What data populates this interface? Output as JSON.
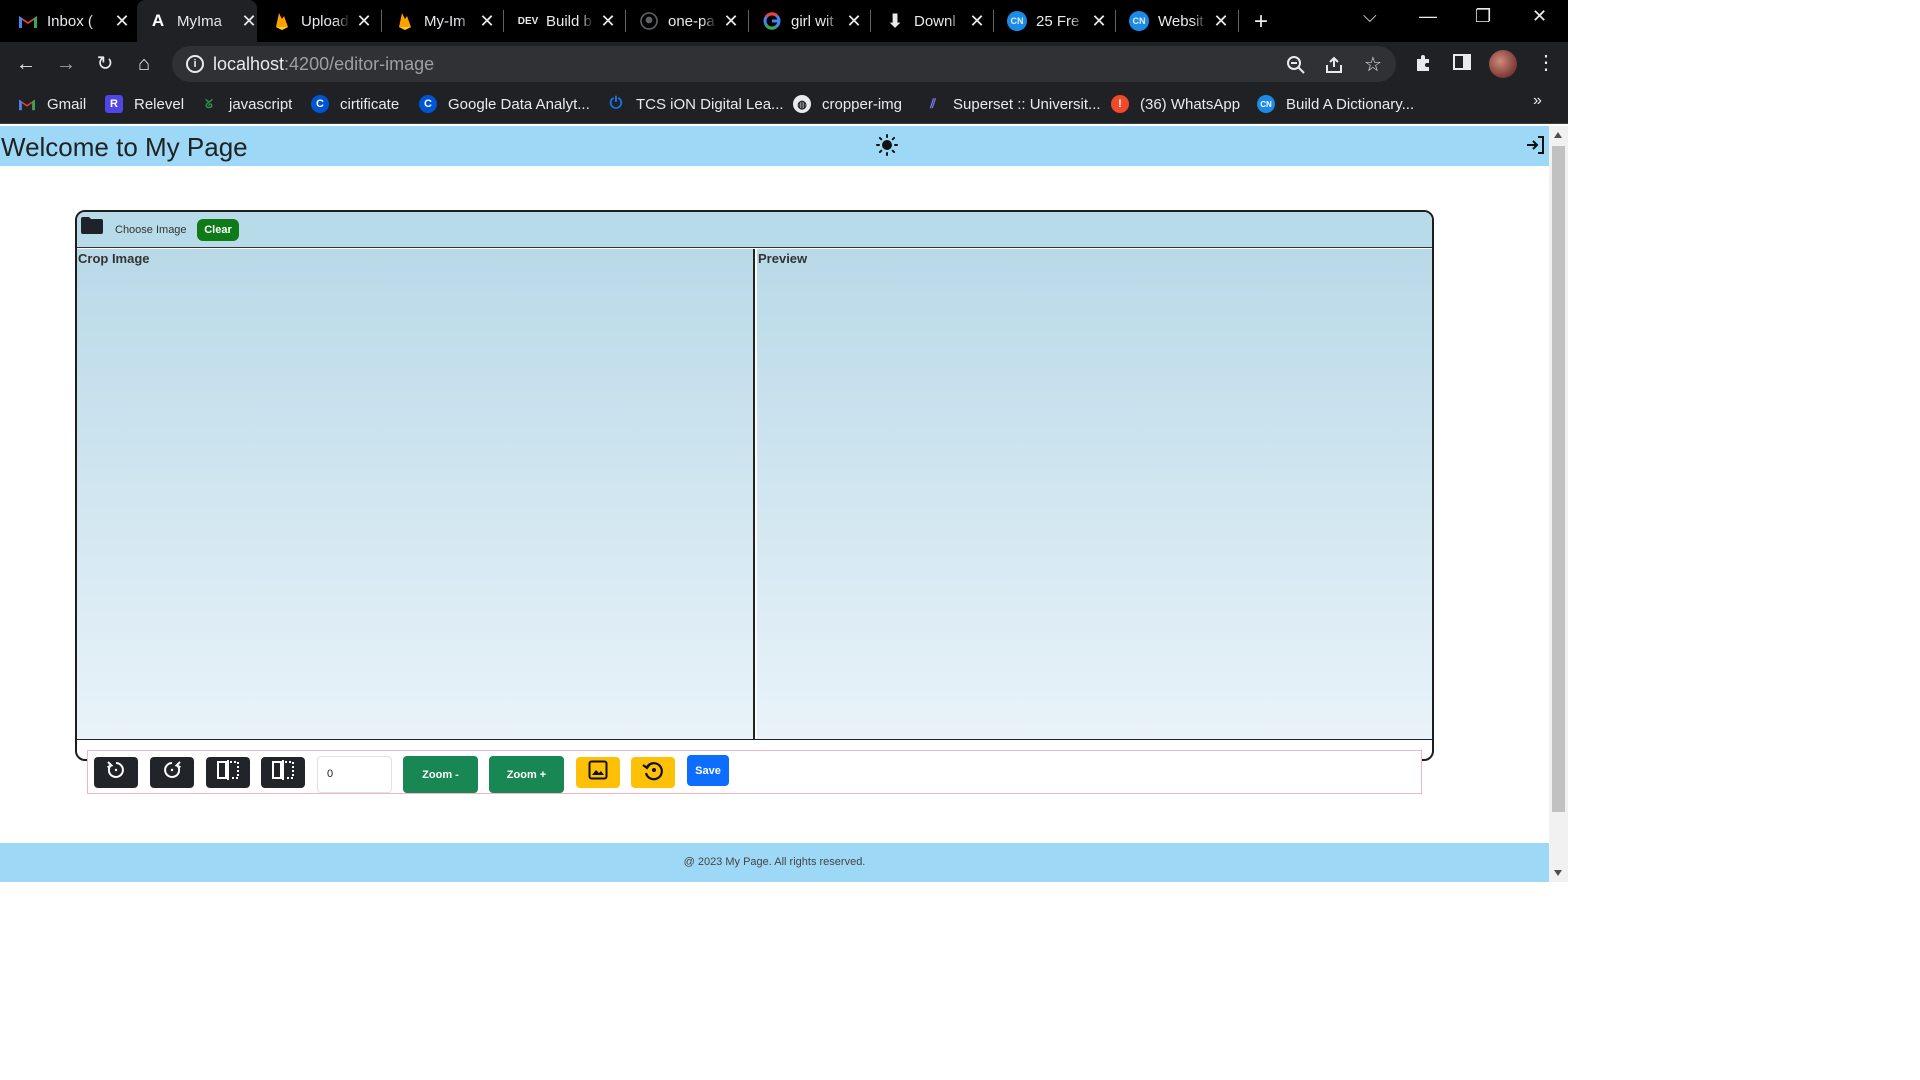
{
  "browser": {
    "tabs": [
      {
        "title": "Inbox (",
        "icon": "gmail-icon"
      },
      {
        "title": "MyIma",
        "icon": "angular-icon"
      },
      {
        "title": "Upload",
        "icon": "firebase-icon"
      },
      {
        "title": "My-Im",
        "icon": "firebase-icon"
      },
      {
        "title": "Build b",
        "icon": "dev-icon"
      },
      {
        "title": "one-pa",
        "icon": "github-icon"
      },
      {
        "title": "girl wit",
        "icon": "google-icon"
      },
      {
        "title": "Downl",
        "icon": "download-icon"
      },
      {
        "title": "25 Fre",
        "icon": "codingnepal-icon"
      },
      {
        "title": "Websit",
        "icon": "codingnepal-icon"
      }
    ],
    "dev_label": "DEV",
    "url_host": "localhost",
    "url_path": ":4200/editor-image",
    "bookmarks": [
      {
        "label": "Gmail",
        "icon": "gmail-icon"
      },
      {
        "label": "Relevel",
        "icon": "relevel-icon"
      },
      {
        "label": "javascript",
        "icon": "gfg-icon"
      },
      {
        "label": "cirtificate",
        "icon": "coursera-icon"
      },
      {
        "label": "Google Data Analyt...",
        "icon": "coursera-icon"
      },
      {
        "label": "TCS iON Digital Lea...",
        "icon": "power-icon"
      },
      {
        "label": "cropper-img",
        "icon": "globe-icon"
      },
      {
        "label": "Superset :: Universit...",
        "icon": "superset-icon"
      },
      {
        "label": "(36) WhatsApp",
        "icon": "alert-icon"
      },
      {
        "label": "Build A Dictionary...",
        "icon": "codingnepal-icon"
      }
    ],
    "more_bookmarks": "»"
  },
  "page": {
    "header_title": "Welcome to My Page",
    "choose_image_label": "Choose Image",
    "clear_label": "Clear",
    "crop_label": "Crop Image",
    "preview_label": "Preview",
    "rotation_value": "0",
    "zoom_out_label": "Zoom -",
    "zoom_in_label": "Zoom +",
    "save_label": "Save",
    "footer_text": "@ 2023 My Page. All rights reserved."
  },
  "colors": {
    "header_bg": "#9dd9f7",
    "clear_btn": "#0f7a18",
    "zoom_btn": "#198754",
    "save_btn": "#0d6efd",
    "warn_btn": "#ffc107",
    "dark_btn": "#212529"
  }
}
